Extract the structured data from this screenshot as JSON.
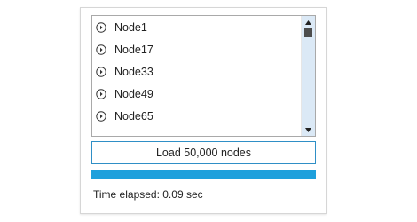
{
  "tree": {
    "items": [
      {
        "label": "Node1",
        "icon": "expand-circle-icon"
      },
      {
        "label": "Node17",
        "icon": "expand-circle-icon"
      },
      {
        "label": "Node33",
        "icon": "expand-circle-icon"
      },
      {
        "label": "Node49",
        "icon": "expand-circle-icon"
      },
      {
        "label": "Node65",
        "icon": "expand-circle-icon"
      }
    ],
    "scrollbar_color": "#dbe9f6"
  },
  "load_button": {
    "label": "Load 50,000 nodes",
    "border_color": "#2f8fc6"
  },
  "progress": {
    "percent": 100,
    "color": "#1ea0dc"
  },
  "status": {
    "elapsed_text": "Time elapsed: 0.09 sec"
  }
}
